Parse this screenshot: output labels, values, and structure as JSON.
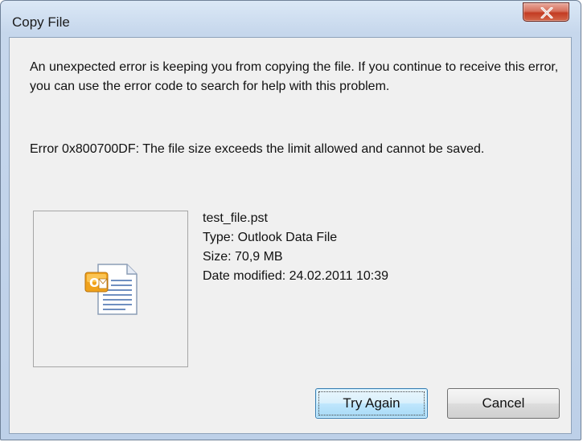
{
  "window": {
    "title": "Copy File",
    "close_icon": "close-icon"
  },
  "message": {
    "text": "An unexpected error is keeping you from copying the file. If you continue to receive this error, you can use the error code to search for help with this problem.",
    "error": "Error 0x800700DF: The file size exceeds the limit allowed and cannot be saved."
  },
  "file": {
    "icon": "outlook-data-file-icon",
    "name": "test_file.pst",
    "type": "Type: Outlook Data File",
    "size": "Size: 70,9 MB",
    "date_modified": "Date modified: 24.02.2011 10:39"
  },
  "buttons": {
    "try_again": "Try Again",
    "cancel": "Cancel"
  },
  "colors": {
    "title_gradient_top": "#dbe8f6",
    "client_bg": "#f0f0f0",
    "close_red": "#c33b22",
    "primary_button_border": "#3c7fb1"
  }
}
